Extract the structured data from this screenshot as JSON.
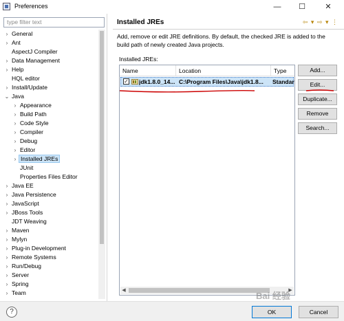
{
  "window": {
    "title": "Preferences",
    "min": "—",
    "max": "☐",
    "close": "✕"
  },
  "filter": {
    "placeholder": "type filter text"
  },
  "tree": [
    {
      "label": "General",
      "arrow": "›",
      "indent": 0
    },
    {
      "label": "Ant",
      "arrow": "›",
      "indent": 0
    },
    {
      "label": "AspectJ Compiler",
      "arrow": "",
      "indent": 0
    },
    {
      "label": "Data Management",
      "arrow": "›",
      "indent": 0
    },
    {
      "label": "Help",
      "arrow": "›",
      "indent": 0
    },
    {
      "label": "HQL editor",
      "arrow": "",
      "indent": 0
    },
    {
      "label": "Install/Update",
      "arrow": "›",
      "indent": 0
    },
    {
      "label": "Java",
      "arrow": "⌄",
      "indent": 0
    },
    {
      "label": "Appearance",
      "arrow": "›",
      "indent": 1
    },
    {
      "label": "Build Path",
      "arrow": "›",
      "indent": 1
    },
    {
      "label": "Code Style",
      "arrow": "›",
      "indent": 1
    },
    {
      "label": "Compiler",
      "arrow": "›",
      "indent": 1
    },
    {
      "label": "Debug",
      "arrow": "›",
      "indent": 1
    },
    {
      "label": "Editor",
      "arrow": "›",
      "indent": 1
    },
    {
      "label": "Installed JREs",
      "arrow": "›",
      "indent": 1,
      "selected": true
    },
    {
      "label": "JUnit",
      "arrow": "",
      "indent": 1
    },
    {
      "label": "Properties Files Editor",
      "arrow": "",
      "indent": 1
    },
    {
      "label": "Java EE",
      "arrow": "›",
      "indent": 0
    },
    {
      "label": "Java Persistence",
      "arrow": "›",
      "indent": 0
    },
    {
      "label": "JavaScript",
      "arrow": "›",
      "indent": 0
    },
    {
      "label": "JBoss Tools",
      "arrow": "›",
      "indent": 0
    },
    {
      "label": "JDT Weaving",
      "arrow": "",
      "indent": 0
    },
    {
      "label": "Maven",
      "arrow": "›",
      "indent": 0
    },
    {
      "label": "Mylyn",
      "arrow": "›",
      "indent": 0
    },
    {
      "label": "Plug-in Development",
      "arrow": "›",
      "indent": 0
    },
    {
      "label": "Remote Systems",
      "arrow": "›",
      "indent": 0
    },
    {
      "label": "Run/Debug",
      "arrow": "›",
      "indent": 0
    },
    {
      "label": "Server",
      "arrow": "›",
      "indent": 0
    },
    {
      "label": "Spring",
      "arrow": "›",
      "indent": 0
    },
    {
      "label": "Team",
      "arrow": "›",
      "indent": 0
    }
  ],
  "page": {
    "title": "Installed JREs",
    "nav": "⇦ ▾ ⇨ ▾ ⋮",
    "description": "Add, remove or edit JRE definitions. By default, the checked JRE is added to the build path of newly created Java projects.",
    "group_label": "Installed JREs:"
  },
  "table": {
    "columns": [
      "Name",
      "Location",
      "Type"
    ],
    "rows": [
      {
        "checked": "✓",
        "name": "jdk1.8.0_14...",
        "location": "C:\\Program Files\\Java\\jdk1.8...",
        "type": "Standar"
      }
    ]
  },
  "buttons": [
    "Add...",
    "Edit...",
    "Duplicate...",
    "Remove",
    "Search..."
  ],
  "footer": {
    "help": "?",
    "ok": "OK",
    "cancel": "Cancel"
  },
  "watermark": "Bai 经验",
  "colors": {
    "selection": "#cce4f7",
    "accent": "#0078d7",
    "annotation": "#cc0000"
  }
}
